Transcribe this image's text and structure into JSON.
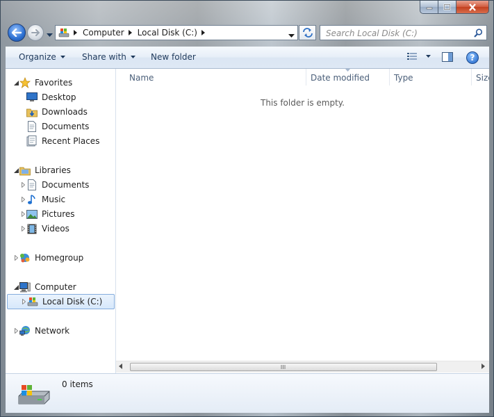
{
  "window": {
    "caption_buttons": [
      "minimize-icon",
      "maximize-icon",
      "close-icon"
    ]
  },
  "address": {
    "crumbs": [
      "Computer",
      "Local Disk (C:)"
    ],
    "search_placeholder": "Search Local Disk (C:)"
  },
  "toolbar": {
    "organize": "Organize",
    "share_with": "Share with",
    "new_folder": "New folder",
    "help": "?"
  },
  "nav": {
    "favorites": "Favorites",
    "desktop": "Desktop",
    "downloads": "Downloads",
    "documents": "Documents",
    "recent_places": "Recent Places",
    "libraries": "Libraries",
    "lib_documents": "Documents",
    "music": "Music",
    "pictures": "Pictures",
    "videos": "Videos",
    "homegroup": "Homegroup",
    "computer": "Computer",
    "local_disk": "Local Disk (C:)",
    "network": "Network"
  },
  "content": {
    "columns": [
      "Name",
      "Date modified",
      "Type",
      "Size"
    ],
    "empty_message": "This folder is empty."
  },
  "details": {
    "item_count": "0 items"
  },
  "colors": {
    "accent": "#1e395b",
    "selection_border": "#84acdd",
    "column_header_text": "#4c607a"
  }
}
